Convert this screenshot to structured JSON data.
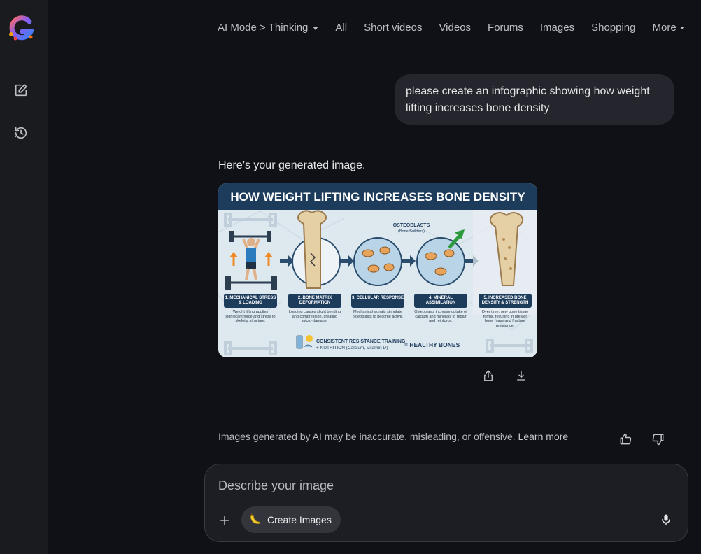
{
  "nav": {
    "tabs": [
      {
        "label": "AI Mode > Thinking",
        "has_dropdown": true
      },
      {
        "label": "All"
      },
      {
        "label": "Short videos"
      },
      {
        "label": "Videos"
      },
      {
        "label": "Forums"
      },
      {
        "label": "Images"
      },
      {
        "label": "Shopping"
      },
      {
        "label": "More",
        "has_dropdown": true
      }
    ]
  },
  "sidebar": {
    "icons": [
      "new-chat-icon",
      "history-icon"
    ]
  },
  "conversation": {
    "user_message": "please create an infographic showing how weight lifting increases bone density",
    "response_text": "Here’s your generated image.",
    "image": {
      "title": "HOW WEIGHT LIFTING INCREASES BONE DENSITY",
      "osteoblasts_label": "OSTEOBLASTS",
      "osteoblasts_sub": "(Bone Builders)",
      "steps": [
        {
          "title": "1. MECHANICAL STRESS & LOADING",
          "desc": "Weight lifting applies significant force and stress to skeletal structure."
        },
        {
          "title": "2. BONE MATRIX DEFORMATION",
          "desc": "Loading causes slight bending and compression, creating micro-damage."
        },
        {
          "title": "3. CELLULAR RESPONSE",
          "desc": "Mechanical signals stimulate osteoblasts to become active."
        },
        {
          "title": "4. MINERAL ASSIMILATION",
          "desc": "Osteoblasts increase uptake of calcium and minerals to repair and reinforce."
        },
        {
          "title": "5. INCREASED BONE DENSITY & STRENGTH",
          "desc": "Over time, new bone tissue forms, resulting in greater bone mass and fracture resistance."
        }
      ],
      "footer_line1": "CONSISTENT RESISTANCE TRAINING",
      "footer_line2": "+ NUTRITION (Calcium, Vitamin D)",
      "footer_result": "= HEALTHY BONES"
    }
  },
  "disclaimer": {
    "text": "Images generated by AI may be inaccurate, misleading, or offensive.",
    "link": "Learn more"
  },
  "composer": {
    "placeholder": "Describe your image",
    "tool_chip": "Create Images"
  },
  "colors": {
    "background": "#0f1117",
    "sidebar": "#1a1b1f",
    "bubble": "#24252d",
    "composer": "#1d1e24",
    "chip": "#34353c",
    "infographic_header": "#1d3c5c",
    "bone": "#e5cfa5"
  }
}
